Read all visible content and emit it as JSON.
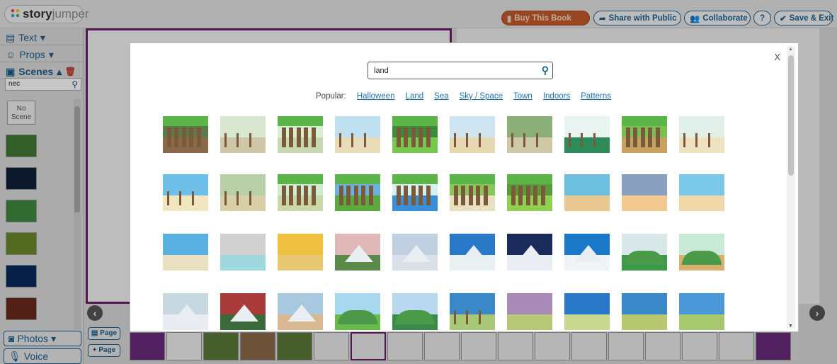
{
  "topbar": {
    "logo_prefix": "story",
    "logo_suffix": "jumper",
    "buy_label": "Buy This Book",
    "share_label": "Share with Public",
    "collaborate_label": "Collaborate",
    "help_label": "?",
    "save_label": "Save & Exit"
  },
  "left_panel": {
    "text_label": "Text",
    "props_label": "Props",
    "scenes_label": "Scenes",
    "search_value": "nec",
    "no_scene_label": "No Scene",
    "photos_label": "Photos",
    "voice_label": "Voice"
  },
  "page_buttons": {
    "page_label": "Page",
    "add_page_label": "Page"
  },
  "modal": {
    "close_label": "X",
    "search_value": "land",
    "popular_label": "Popular:",
    "popular_links": [
      "Halloween",
      "Land",
      "Sea",
      "Sky / Space",
      "Town",
      "Indoors",
      "Patterns"
    ]
  },
  "scene_rows": [
    [
      {
        "name": "forest-brown",
        "sky": "#5a7a4a",
        "ground": "#8a6a4a",
        "kind": "forest"
      },
      {
        "name": "jungle-path",
        "sky": "#d8e8d0",
        "ground": "#cfc7a8",
        "kind": "trees"
      },
      {
        "name": "forest-trunks",
        "sky": "#d8f0d0",
        "ground": "#c8d8b0",
        "kind": "trunks"
      },
      {
        "name": "savanna",
        "sky": "#bfe0f0",
        "ground": "#e8dcb8",
        "kind": "trees"
      },
      {
        "name": "green-clearing",
        "sky": "#3c8c3c",
        "ground": "#78c850",
        "kind": "forest"
      },
      {
        "name": "palm-beach",
        "sky": "#cfe6f2",
        "ground": "#e6d8b0",
        "kind": "trees"
      },
      {
        "name": "dense-jungle",
        "sky": "#8ab078",
        "ground": "#d0c8a8",
        "kind": "trees"
      },
      {
        "name": "mangrove",
        "sky": "#e8f4f0",
        "ground": "#2e8a58",
        "kind": "trees"
      },
      {
        "name": "autumn-forest",
        "sky": "#7ac050",
        "ground": "#c8a060",
        "kind": "trunks"
      },
      {
        "name": "sandy-clearing",
        "sky": "#e0f0e8",
        "ground": "#eee2c0",
        "kind": "trees"
      }
    ],
    [
      {
        "name": "bright-savanna",
        "sky": "#6ec0e8",
        "ground": "#f0e6c0",
        "kind": "trees"
      },
      {
        "name": "dusky-jungle",
        "sky": "#b8d0a8",
        "ground": "#d8cfa8",
        "kind": "trees"
      },
      {
        "name": "village-forest",
        "sky": "#d0ecd0",
        "ground": "#c8d8a8",
        "kind": "trunks"
      },
      {
        "name": "sunny-forest",
        "sky": "#6ab0e0",
        "ground": "#5aaa40",
        "kind": "forest"
      },
      {
        "name": "river-forest",
        "sky": "#d8f0f0",
        "ground": "#3a90d8",
        "kind": "trunks"
      },
      {
        "name": "tall-forest",
        "sky": "#88c858",
        "ground": "#e8e0c0",
        "kind": "trunks"
      },
      {
        "name": "flower-meadow",
        "sky": "#5a9a3a",
        "ground": "#90d050",
        "kind": "forest"
      },
      {
        "name": "calm-beach",
        "sky": "#6fc0e0",
        "ground": "#e8c890",
        "kind": "flat"
      },
      {
        "name": "sunset-sea",
        "sky": "#8aa0c0",
        "ground": "#f0c890",
        "kind": "flat"
      },
      {
        "name": "turquoise-beach",
        "sky": "#7cc8e8",
        "ground": "#f0d8a8",
        "kind": "flat"
      }
    ],
    [
      {
        "name": "island-bay",
        "sky": "#5ab0e0",
        "ground": "#e8e0c0",
        "kind": "flat"
      },
      {
        "name": "grey-bay",
        "sky": "#d0d0d0",
        "ground": "#a0d8e0",
        "kind": "flat"
      },
      {
        "name": "golden-sunset",
        "sky": "#f0c040",
        "ground": "#e8c870",
        "kind": "flat"
      },
      {
        "name": "volcano",
        "sky": "#e0b8b8",
        "ground": "#5a8a4a",
        "kind": "mountain"
      },
      {
        "name": "snowy-ridge",
        "sky": "#c0d0e0",
        "ground": "#d8e0e8",
        "kind": "mountain"
      },
      {
        "name": "blue-peak",
        "sky": "#2a78c8",
        "ground": "#e8f0f4",
        "kind": "mountain"
      },
      {
        "name": "alpine-pines",
        "sky": "#1a2a5a",
        "ground": "#e8eef4",
        "kind": "mountain"
      },
      {
        "name": "snowcap",
        "sky": "#1a78c8",
        "ground": "#f0f4f8",
        "kind": "mountain"
      },
      {
        "name": "green-valley",
        "sky": "#d8e8e8",
        "ground": "#3a9a4a",
        "kind": "hill"
      },
      {
        "name": "canyon-road",
        "sky": "#c8e8d8",
        "ground": "#d8b070",
        "kind": "hill"
      }
    ],
    [
      {
        "name": "winter-field",
        "sky": "#c8d8e0",
        "ground": "#e8ecf0",
        "kind": "mountain"
      },
      {
        "name": "red-volcano",
        "sky": "#a83a3a",
        "ground": "#3a6a3a",
        "kind": "mountain"
      },
      {
        "name": "desert-dunes",
        "sky": "#a8c8e0",
        "ground": "#d8b890",
        "kind": "mountain"
      },
      {
        "name": "golf-hill",
        "sky": "#a8d8f0",
        "ground": "#6aba4a",
        "kind": "hill"
      },
      {
        "name": "green-mound",
        "sky": "#b8d8f0",
        "ground": "#3a8a4a",
        "kind": "hill"
      },
      {
        "name": "lone-tree",
        "sky": "#3a88c8",
        "ground": "#a8c878",
        "kind": "trees"
      },
      {
        "name": "dusk-plain",
        "sky": "#a88ab8",
        "ground": "#b8c878",
        "kind": "flat"
      },
      {
        "name": "open-plain",
        "sky": "#2a78c8",
        "ground": "#c8d890",
        "kind": "flat"
      },
      {
        "name": "fenced-plain",
        "sky": "#3a88c8",
        "ground": "#b8c870",
        "kind": "flat"
      },
      {
        "name": "grassy-plain",
        "sky": "#4a98d8",
        "ground": "#a8c870",
        "kind": "flat"
      }
    ]
  ],
  "left_thumbs": [
    {
      "color": "#3f7a33"
    },
    {
      "color": "#10203a"
    },
    {
      "color": "#3f8a3f"
    },
    {
      "color": "#6a8a2a"
    },
    {
      "color": "#0a2a5a"
    },
    {
      "color": "#6a2a1a"
    }
  ]
}
